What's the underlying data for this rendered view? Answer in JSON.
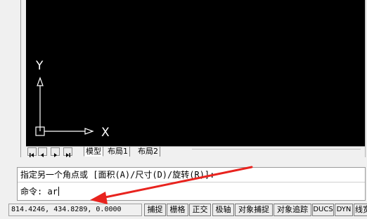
{
  "layout_tabs": {
    "model": "模型",
    "layout1": "布局1",
    "layout2": "布局2"
  },
  "ucs_icon": {
    "y_label": "Y",
    "x_label": "X"
  },
  "command": {
    "prompt_line": "指定另一个角点或 [面积(A)/尺寸(D)/旋转(R)]:",
    "input_label": "命令:",
    "input_value": "ar"
  },
  "status_bar": {
    "coordinates": "814.4246, 434.8289, 0.0000",
    "toggles": [
      {
        "label": "捕捉"
      },
      {
        "label": "栅格"
      },
      {
        "label": "正交"
      },
      {
        "label": "极轴"
      },
      {
        "label": "对象捕捉"
      },
      {
        "label": "对象追踪"
      },
      {
        "label": "DUCS"
      },
      {
        "label": "DYN"
      },
      {
        "label": "线宽"
      }
    ]
  },
  "colors": {
    "viewport_bg": "#000000",
    "annotation_arrow": "#e8231e"
  },
  "icons": [
    "first-icon",
    "prev-icon",
    "next-icon",
    "last-icon"
  ]
}
